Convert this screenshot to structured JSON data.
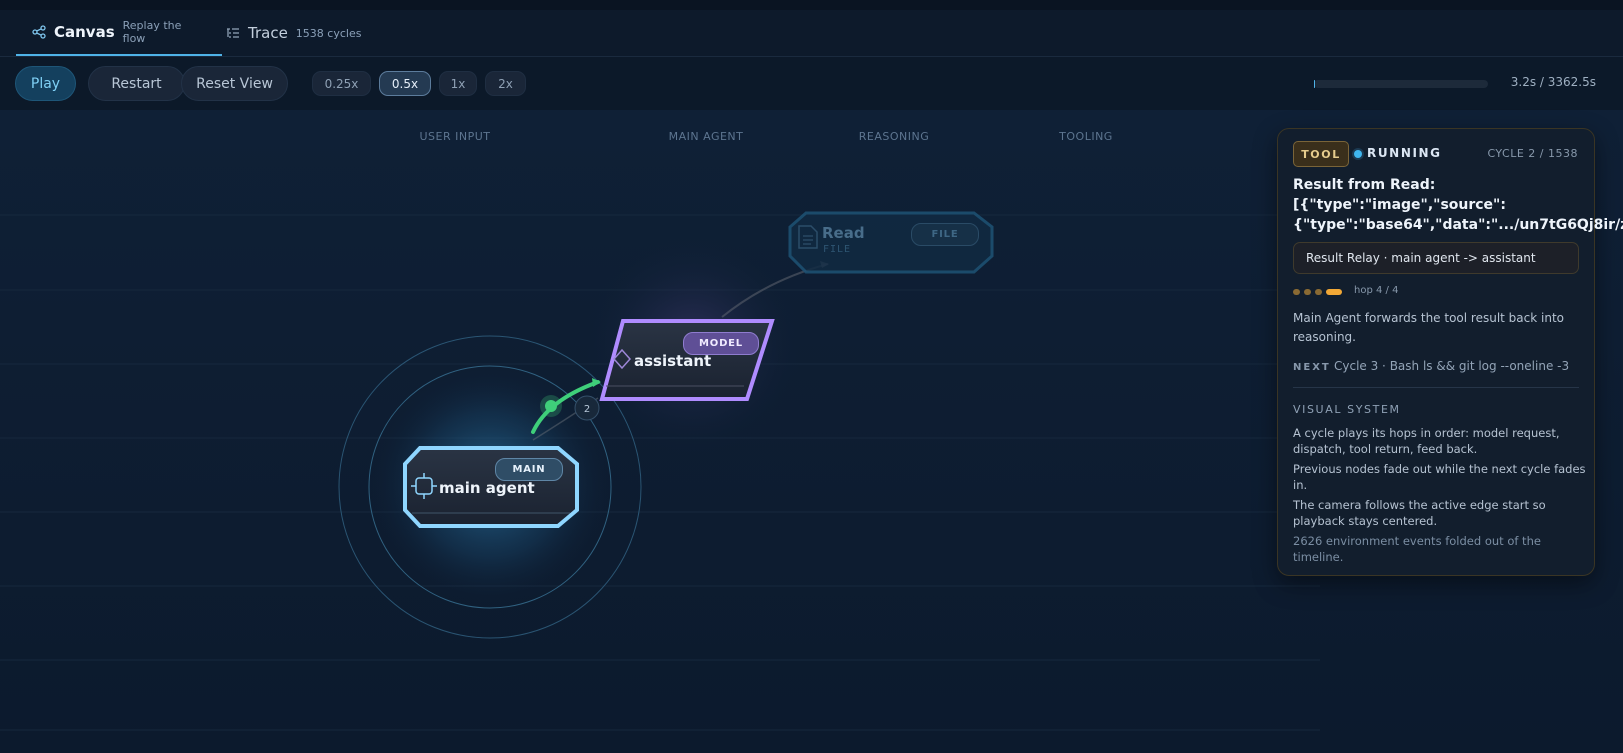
{
  "tabs": [
    {
      "label": "Canvas",
      "sub": "Replay the flow",
      "icon": "share-nodes-icon"
    },
    {
      "label": "Trace",
      "sub": "1538 cycles",
      "icon": "list-tree-icon"
    }
  ],
  "toolbar": {
    "play": "Play",
    "restart": "Restart",
    "reset_view": "Reset View",
    "speeds": [
      "0.25x",
      "0.5x",
      "1x",
      "2x"
    ],
    "selected_speed": "0.5x",
    "progress": 0.001,
    "time": "3.2s / 3362.5s"
  },
  "lanes": [
    "USER INPUT",
    "MAIN AGENT",
    "REASONING",
    "TOOLING"
  ],
  "nodes": {
    "main": {
      "label": "main agent",
      "badge": "MAIN"
    },
    "assistant": {
      "label": "assistant",
      "badge": "MODEL"
    },
    "read": {
      "label": "Read",
      "sub": "FILE",
      "badge": "FILE"
    }
  },
  "edge_count": "2",
  "panel": {
    "kind": "TOOL",
    "status": "RUNNING",
    "cycle": "CYCLE 2 / 1538",
    "title": "Result from Read:\n[{\"type\":\"image\",\"source\":\n{\"type\":\"base64\",\"data\":\".../un7tG6Qj8ir/zrbk...",
    "relay": "Result Relay · main agent -> assistant",
    "hop": "hop 4 / 4",
    "description": "Main Agent forwards the tool result back into reasoning.",
    "next_label": "NEXT",
    "next_value": "Cycle 3 · Bash ls && git log --oneline -3",
    "visual_system_title": "VISUAL SYSTEM",
    "visual_lines": [
      "A cycle plays its hops in order: model request, dispatch, tool return, feed back.",
      "Previous nodes fade out while the next cycle fades in.",
      "The camera follows the active edge start so playback stays centered.",
      "2626 environment events folded out of the timeline."
    ]
  },
  "colors": {
    "accent": "#4fb3e8",
    "main_node": "#8fd6ff",
    "model_node": "#b08cff",
    "active_edge": "#3fcf7a",
    "tool_amber": "#f2a836"
  }
}
